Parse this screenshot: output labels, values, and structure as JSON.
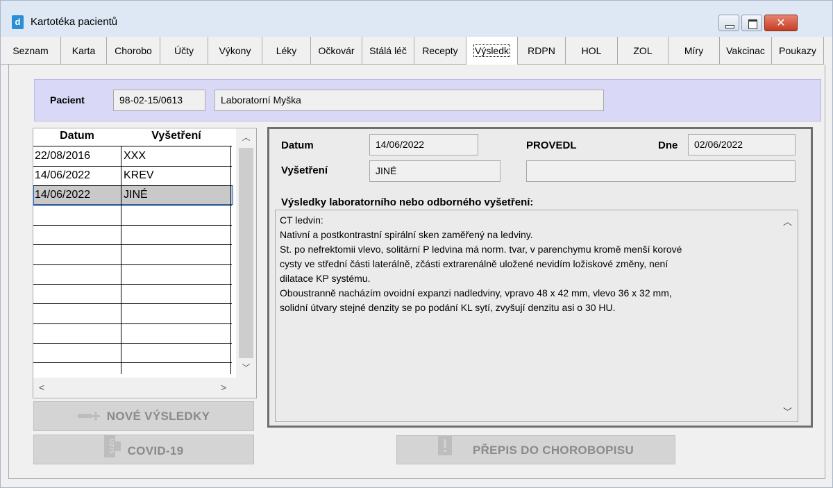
{
  "window": {
    "title": "Kartotéka pacientů",
    "icon_letter": "d"
  },
  "tabs": [
    {
      "label": "Seznam"
    },
    {
      "label": "Karta"
    },
    {
      "label": "Chorobo"
    },
    {
      "label": "Účty"
    },
    {
      "label": "Výkony"
    },
    {
      "label": "Léky"
    },
    {
      "label": "Očkovár"
    },
    {
      "label": "Stálá léč"
    },
    {
      "label": "Recepty"
    },
    {
      "label": "Výsledk"
    },
    {
      "label": "RDPN"
    },
    {
      "label": "HOL"
    },
    {
      "label": "ZOL"
    },
    {
      "label": "Míry"
    },
    {
      "label": "Vakcinac"
    },
    {
      "label": "Poukazy"
    }
  ],
  "active_tab": "Výsledk",
  "patient": {
    "label": "Pacient",
    "id": "98-02-15/0613",
    "name": "Laboratorní Myška"
  },
  "grid": {
    "headers": [
      "Datum",
      "Vyšetření"
    ],
    "rows": [
      {
        "date": "22/08/2016",
        "exam": "XXX"
      },
      {
        "date": "14/06/2022",
        "exam": "KREV"
      },
      {
        "date": "14/06/2022",
        "exam": "JINÉ"
      }
    ],
    "selected_row": 2
  },
  "buttons": {
    "new_results": "NOVÉ VÝSLEDKY",
    "covid": "COVID-19",
    "transcribe": "PŘEPIS DO CHOROBOPISU"
  },
  "detail": {
    "date_label": "Datum",
    "date_value": "14/06/2022",
    "provedl_label": "PROVEDL",
    "dne_label": "Dne",
    "dne_value": "02/06/2022",
    "exam_label": "Vyšetření",
    "exam_value": "JINÉ",
    "provedl_value": "",
    "results_label": "Výsledky laboratorního nebo odborného vyšetření:",
    "results_lines": [
      "CT ledvin:",
      "Nativní a postkontrastní spirální sken zaměřený na ledviny.",
      "St. po nefrektomii vlevo, solitární P ledvina má norm. tvar, v parenchymu kromě menší korové",
      "cysty ve střední části laterálně, zčásti extrarenálně uložené nevidím ložiskové změny, není",
      "dilatace KP systému.",
      "Oboustranně nacházím ovoidní expanzi nadledviny, vpravo 48 x 42 mm, vlevo 36 x 32 mm,",
      "solidní útvary stejné denzity se po podání KL sytí, zvyšují denzitu asi o 30 HU."
    ]
  },
  "colors": {
    "patient_bar": "#d9d9f7",
    "selection_border": "#1e6dd6",
    "close_button": "#c43c23"
  }
}
